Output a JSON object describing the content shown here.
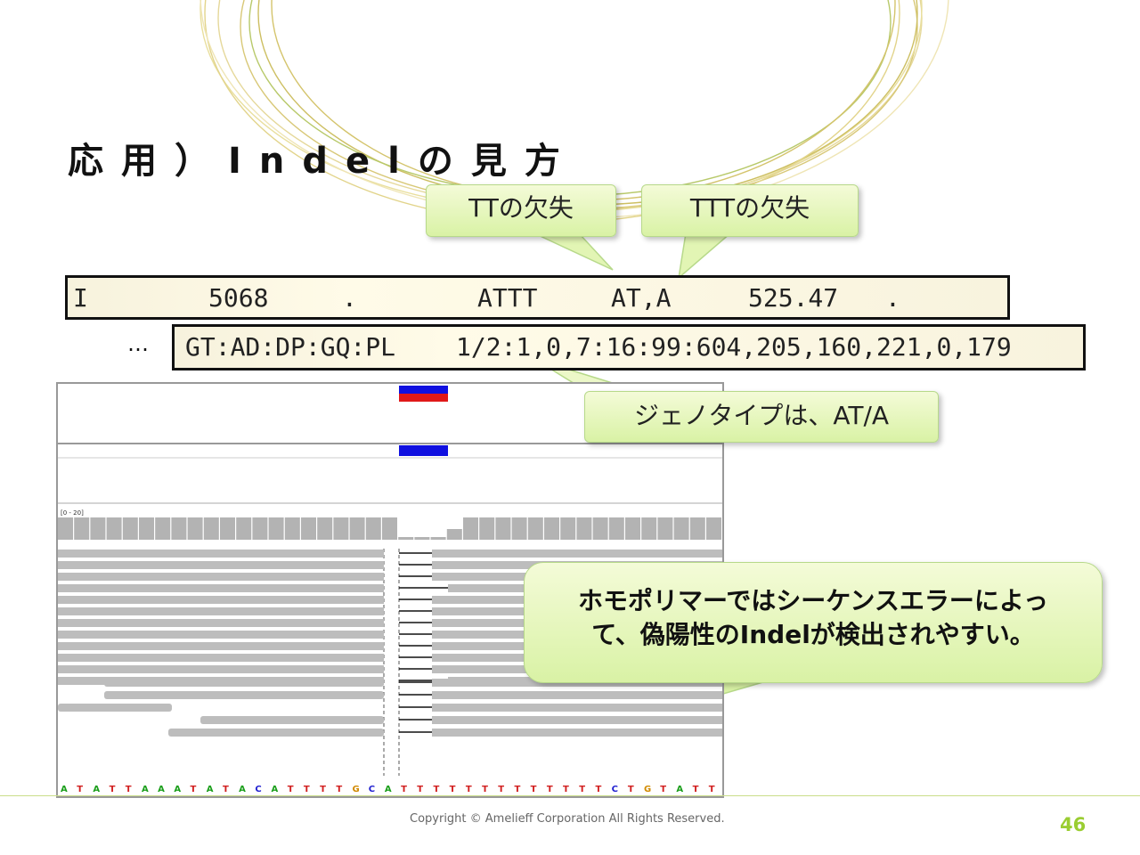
{
  "slide": {
    "title": "応用）Indelの見方",
    "footer": "Copyright © Amelieff Corporation All Rights Reserved.",
    "page_number": "46"
  },
  "callouts": {
    "tt_deletion": "TTの欠失",
    "ttt_deletion": "TTTの欠失",
    "genotype": "ジェノタイプは、AT/A",
    "homopolymer_line1": "ホモポリマーではシーケンスエラーによっ",
    "homopolymer_line2": "て、偽陽性のIndelが検出されやすい。"
  },
  "vcf_row": {
    "chrom": "I",
    "pos": "5068",
    "id": ".",
    "ref": "ATTT",
    "alt": "AT,A",
    "qual": "525.47",
    "filter": "."
  },
  "format_row": {
    "ellipsis": "…",
    "format": "GT:AD:DP:GQ:PL",
    "sample": "1/2:1,0,7:16:99:604,205,160,221,0,179"
  },
  "igv": {
    "coverage_range": "[0 - 20]",
    "sequence": "ATATTAAATATACATTTTGCATTTTTTTTTTTTTCTGTATT",
    "base_colors": {
      "A": "#1a9e1a",
      "T": "#d11f1f",
      "C": "#2020d0",
      "G": "#d18a00"
    }
  },
  "colors": {
    "accent": "#9acd32",
    "variant_red": "#e01818",
    "variant_blue": "#1010e0"
  }
}
